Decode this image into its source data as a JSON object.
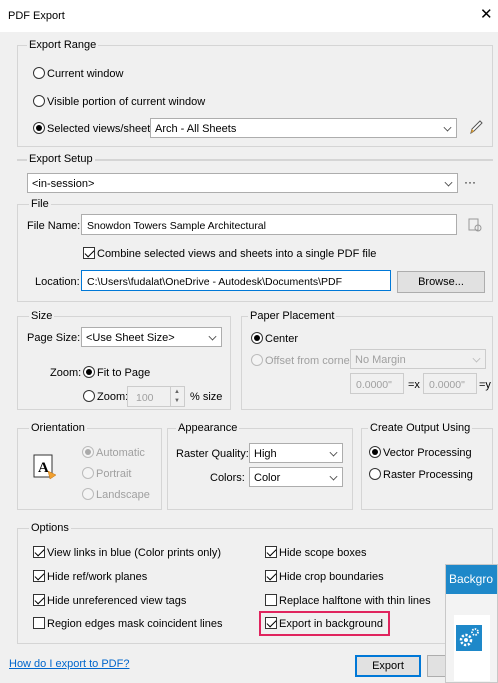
{
  "window": {
    "title": "PDF Export",
    "close_glyph": "✕"
  },
  "export_range": {
    "legend": "Export Range",
    "current_window": "Current window",
    "visible_portion": "Visible portion of current window",
    "selected_views": "Selected views/sheets",
    "selected_value": "Arch - All Sheets",
    "edit_icon": "pencil-icon"
  },
  "export_setup": {
    "legend": "Export Setup",
    "value": "<in-session>",
    "more_glyph": "···"
  },
  "file": {
    "legend": "File",
    "name_label": "File Name:",
    "name_value": "Snowdon Towers Sample Architectural",
    "combine_label": "Combine selected views and sheets into a single PDF file",
    "location_label": "Location:",
    "location_value": "C:\\Users\\fudalat\\OneDrive - Autodesk\\Documents\\PDF",
    "browse": "Browse..."
  },
  "size": {
    "legend": "Size",
    "page_size_label": "Page Size:",
    "page_size_value": "<Use Sheet Size>",
    "zoom_label": "Zoom:",
    "fit_to_page": "Fit to Page",
    "zoom_option": "Zoom:",
    "zoom_value": "100",
    "percent_size": "% size"
  },
  "paper_placement": {
    "legend": "Paper Placement",
    "center": "Center",
    "offset_label": "Offset from corner:",
    "offset_value": "No Margin",
    "x_value": "0.0000\"",
    "x_suffix": "=x",
    "y_value": "0.0000\"",
    "y_suffix": "=y"
  },
  "orientation": {
    "legend": "Orientation",
    "automatic": "Automatic",
    "portrait": "Portrait",
    "landscape": "Landscape"
  },
  "appearance": {
    "legend": "Appearance",
    "raster_quality_label": "Raster Quality:",
    "raster_quality_value": "High",
    "colors_label": "Colors:",
    "colors_value": "Color"
  },
  "output": {
    "legend": "Create Output Using",
    "vector": "Vector Processing",
    "raster": "Raster Processing"
  },
  "options": {
    "legend": "Options",
    "view_links": "View links in blue (Color prints only)",
    "hide_ref": "Hide ref/work planes",
    "hide_unref": "Hide unreferenced view tags",
    "region_edges": "Region edges mask coincident lines",
    "hide_scope": "Hide scope boxes",
    "hide_crop": "Hide crop boundaries",
    "replace_halftone": "Replace halftone with thin lines",
    "export_background": "Export in background"
  },
  "footer": {
    "help_link": "How do I export to PDF?",
    "export_button": "Export"
  },
  "toast": {
    "title": "Backgro"
  },
  "colors": {
    "accent": "#0078d7",
    "highlight": "#e0245e",
    "toast_header": "#1e88c9"
  }
}
